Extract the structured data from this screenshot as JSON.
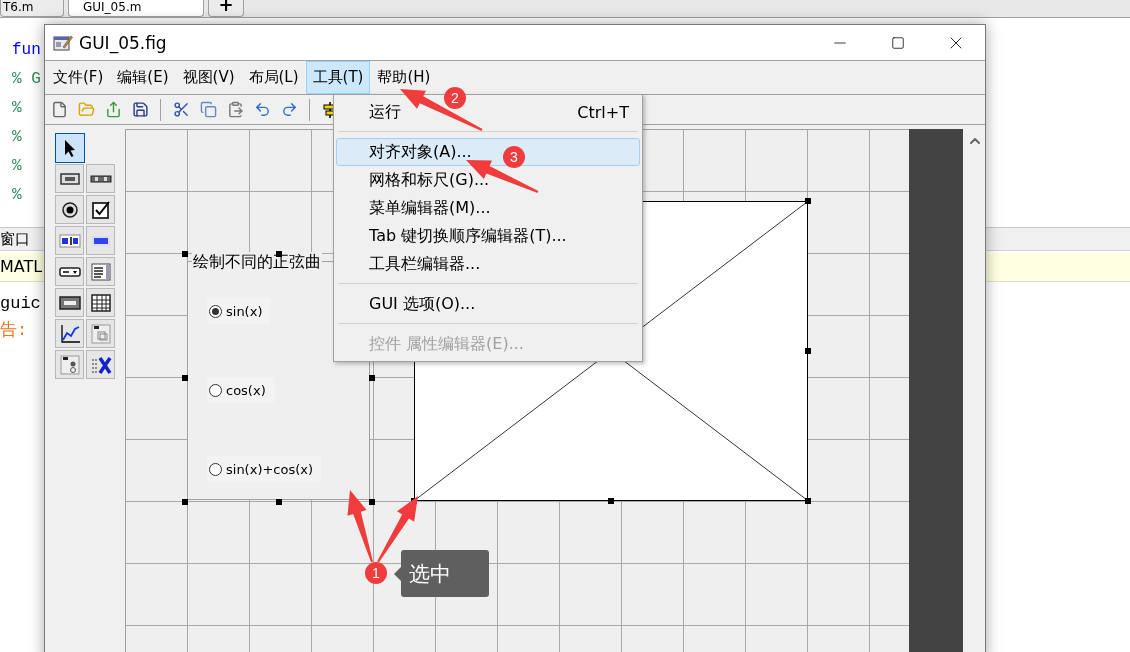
{
  "editor": {
    "tabs": [
      {
        "label": "T6.m",
        "selected": false
      },
      {
        "label": "GUI_05.m",
        "selected": true
      }
    ],
    "new_tab": "+",
    "code_lines": [
      {
        "text": "fun",
        "kind": "keyword"
      },
      {
        "text": "% G",
        "kind": "comment"
      },
      {
        "text": "%",
        "kind": "comment"
      },
      {
        "text": "%",
        "kind": "comment"
      },
      {
        "text": "%",
        "kind": "comment"
      },
      {
        "text": "%",
        "kind": "comment"
      }
    ]
  },
  "command_window": {
    "title": "窗口",
    "banner": "MATL",
    "lines": [
      {
        "text": "guic",
        "kind": "input"
      },
      {
        "text": "告:",
        "kind": "warning"
      }
    ]
  },
  "window": {
    "title": "GUI_05.fig"
  },
  "menu_bar": [
    {
      "label": "文件(F)",
      "selected": false
    },
    {
      "label": "编辑(E)",
      "selected": false
    },
    {
      "label": "视图(V)",
      "selected": false
    },
    {
      "label": "布局(L)",
      "selected": false
    },
    {
      "label": "工具(T)",
      "selected": true
    },
    {
      "label": "帮助(H)",
      "selected": false
    }
  ],
  "palette": [
    {
      "kind": "pointer",
      "selected": true
    },
    {
      "kind": "push-button",
      "selected": false
    },
    {
      "kind": "slider",
      "selected": false
    },
    {
      "kind": "radio",
      "selected": false
    },
    {
      "kind": "checkbox",
      "selected": false
    },
    {
      "kind": "edit",
      "selected": false
    },
    {
      "kind": "text",
      "selected": false
    },
    {
      "kind": "popup",
      "selected": false
    },
    {
      "kind": "listbox",
      "selected": false
    },
    {
      "kind": "toggle",
      "selected": false
    },
    {
      "kind": "table",
      "selected": false
    },
    {
      "kind": "axes",
      "selected": false
    },
    {
      "kind": "panel",
      "selected": false
    },
    {
      "kind": "button-group",
      "selected": false
    },
    {
      "kind": "activex",
      "selected": false
    }
  ],
  "dropdown": {
    "items": [
      {
        "kind": "item",
        "label": "运行",
        "shortcut": "Ctrl+T",
        "selected": false,
        "disabled": false
      },
      {
        "kind": "separator"
      },
      {
        "kind": "item",
        "label": "对齐对象(A)...",
        "selected": true,
        "disabled": false
      },
      {
        "kind": "item",
        "label": "网格和标尺(G)...",
        "selected": false,
        "disabled": false
      },
      {
        "kind": "item",
        "label": "菜单编辑器(M)...",
        "selected": false,
        "disabled": false
      },
      {
        "kind": "item",
        "label": "Tab 键切换顺序编辑器(T)...",
        "selected": false,
        "disabled": false
      },
      {
        "kind": "item",
        "label": "工具栏编辑器...",
        "selected": false,
        "disabled": false
      },
      {
        "kind": "separator"
      },
      {
        "kind": "item",
        "label": "GUI 选项(O)...",
        "selected": false,
        "disabled": false
      },
      {
        "kind": "separator"
      },
      {
        "kind": "item",
        "label": "控件 属性编辑器(E)...",
        "selected": false,
        "disabled": true
      }
    ]
  },
  "layout_canvas": {
    "button_group": {
      "title": "绘制不同的正弦曲",
      "selected": true,
      "options": [
        {
          "label": "sin(x)",
          "selected": true
        },
        {
          "label": "cos(x)",
          "selected": false
        },
        {
          "label": "sin(x)+cos(x)",
          "selected": false
        }
      ]
    },
    "axes": {
      "selected": true
    }
  },
  "annotations": {
    "badges": [
      "1",
      "2",
      "3"
    ],
    "callout": "选中"
  }
}
